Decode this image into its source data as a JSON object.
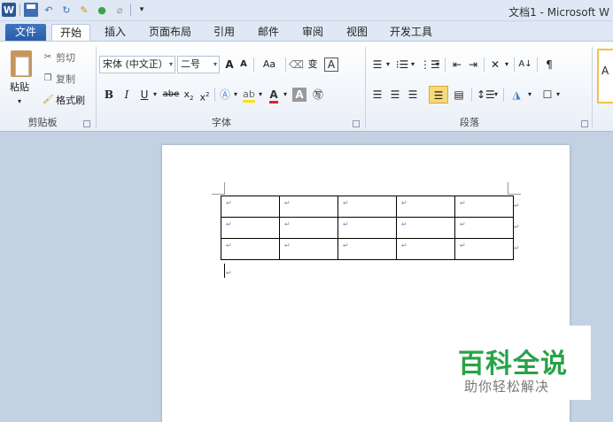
{
  "app": {
    "title": "文档1 - Microsoft W",
    "qat_undo_icon": "undo-icon",
    "qat_redo_icon": "redo-icon"
  },
  "tabs": [
    {
      "label": "文件"
    },
    {
      "label": "开始"
    },
    {
      "label": "插入"
    },
    {
      "label": "页面布局"
    },
    {
      "label": "引用"
    },
    {
      "label": "邮件"
    },
    {
      "label": "审阅"
    },
    {
      "label": "视图"
    },
    {
      "label": "开发工具"
    }
  ],
  "clipboard": {
    "paste_label": "粘贴",
    "cut_label": "剪切",
    "copy_label": "复制",
    "format_painter_label": "格式刷",
    "group_label": "剪贴板"
  },
  "font": {
    "font_name": "宋体 (中文正）",
    "font_size": "二号",
    "grow": "A",
    "shrink": "A",
    "change_case": "Aa",
    "bold": "B",
    "italic": "I",
    "underline": "U",
    "strike": "abe",
    "subscript": "x",
    "superscript": "x",
    "clear": "A",
    "phonetic": "变",
    "border": "A",
    "group_label": "字体"
  },
  "paragraph": {
    "group_label": "段落"
  },
  "styles": {
    "preview": "A"
  },
  "document": {
    "table_rows": 3,
    "table_cols": 5,
    "cell_mark": "↵"
  },
  "watermark": {
    "title": "百科全说",
    "subtitle": "助你轻松解决"
  },
  "colors": {
    "accent": "#2b5797",
    "file_tab": "#3068b8",
    "watermark_green": "#27a346"
  }
}
